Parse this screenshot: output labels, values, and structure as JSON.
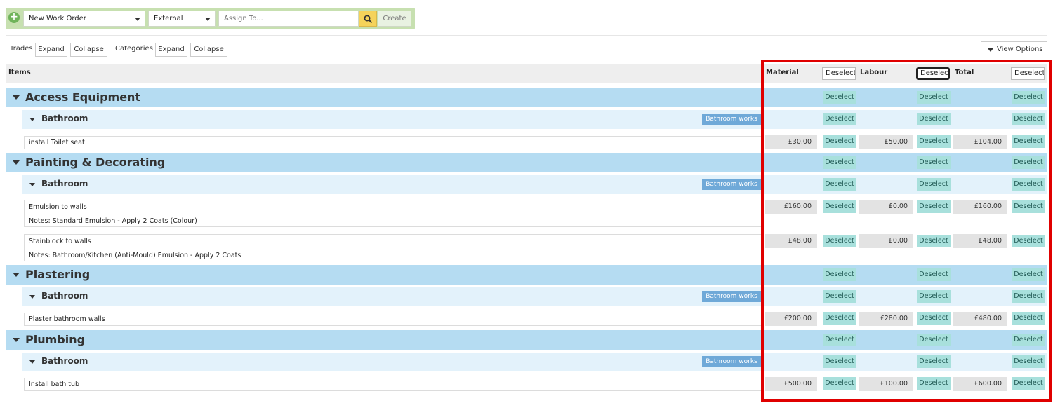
{
  "toolbar": {
    "work_order_type": "New Work Order",
    "contractor_type": "External",
    "assign_placeholder": "Assign To...",
    "create_label": "Create"
  },
  "filters": {
    "trades_label": "Trades",
    "categories_label": "Categories",
    "expand_label": "Expand",
    "collapse_label": "Collapse",
    "view_options_label": "View Options"
  },
  "header": {
    "items": "Items",
    "material": "Material",
    "labour": "Labour",
    "total": "Total",
    "deselect": "Deselect",
    "deselect_truncated": "Deselec"
  },
  "deselect_label": "Deselect",
  "trades": [
    {
      "name": "Access Equipment",
      "category": "Bathroom",
      "tag": "Bathroom works",
      "items": [
        {
          "name": "install Toilet seat",
          "notes": "",
          "material": "£30.00",
          "labour": "£50.00",
          "total": "£104.00"
        }
      ]
    },
    {
      "name": "Painting & Decorating",
      "category": "Bathroom",
      "tag": "Bathroom works",
      "items": [
        {
          "name": "Emulsion to walls",
          "notes": "Notes: Standard Emulsion - Apply 2 Coats (Colour)",
          "material": "£160.00",
          "labour": "£0.00",
          "total": "£160.00"
        },
        {
          "name": "Stainblock to walls",
          "notes": "Notes: Bathroom/Kitchen (Anti-Mould) Emulsion - Apply 2 Coats",
          "material": "£48.00",
          "labour": "£0.00",
          "total": "£48.00"
        }
      ]
    },
    {
      "name": "Plastering",
      "category": "Bathroom",
      "tag": "Bathroom works",
      "items": [
        {
          "name": "Plaster bathroom walls",
          "notes": "",
          "material": "£200.00",
          "labour": "£280.00",
          "total": "£480.00"
        }
      ]
    },
    {
      "name": "Plumbing",
      "category": "Bathroom",
      "tag": "Bathroom works",
      "items": [
        {
          "name": "Install bath tub",
          "notes": "",
          "material": "£500.00",
          "labour": "£100.00",
          "total": "£600.00"
        }
      ]
    }
  ],
  "colors": {
    "trade_row": "#b5dcf2",
    "category_row": "#e3f2fb",
    "deselect_button": "#a8e0dc",
    "tag": "#6fa9d8",
    "highlight_frame": "#e00000",
    "toolbar": "#c7e0b0"
  }
}
